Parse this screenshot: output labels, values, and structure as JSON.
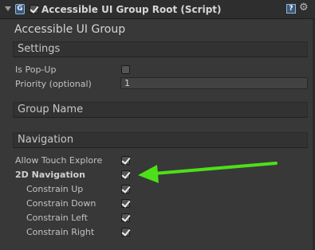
{
  "header": {
    "script_icon_glyph": "G",
    "script_icon_name": "script-icon",
    "enabled": true,
    "title": "Accessible UI Group Root (Script)",
    "help_glyph": "?",
    "gear_glyph": "⚙"
  },
  "component_title": "Accessible UI Group",
  "settings": {
    "header": "Settings",
    "is_popup_label": "Is Pop-Up",
    "is_popup_checked": false,
    "priority_label": "Priority (optional)",
    "priority_value": "1"
  },
  "group_name": {
    "header": "Group Name"
  },
  "navigation": {
    "header": "Navigation",
    "allow_touch_explore_label": "Allow Touch Explore",
    "allow_touch_explore_checked": true,
    "nav_2d_label": "2D Navigation",
    "nav_2d_checked": true,
    "constrain_up_label": "Constrain Up",
    "constrain_up_checked": true,
    "constrain_down_label": "Constrain Down",
    "constrain_down_checked": true,
    "constrain_left_label": "Constrain Left",
    "constrain_left_checked": true,
    "constrain_right_label": "Constrain Right",
    "constrain_right_checked": true
  },
  "colors": {
    "background": "#383838",
    "header_bg": "#2e2e2e",
    "arrow": "#4ce019"
  }
}
